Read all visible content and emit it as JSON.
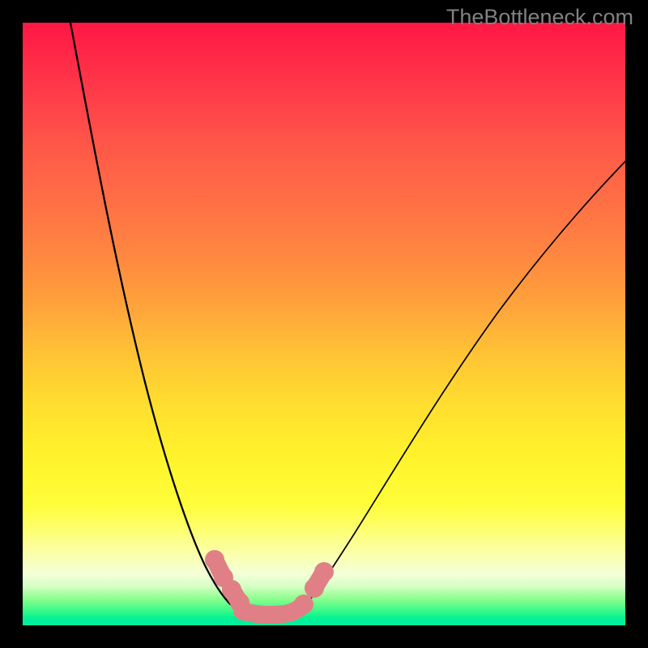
{
  "watermark": "TheBottleneck.com",
  "chart_data": {
    "type": "line",
    "title": "",
    "xlabel": "",
    "ylabel": "",
    "xlim": [
      0,
      100
    ],
    "ylim": [
      0,
      100
    ],
    "grid": false,
    "series": [
      {
        "name": "bottleneck-curve",
        "x": [
          8,
          12,
          18,
          24,
          30,
          34,
          37,
          39,
          42,
          46,
          50,
          56,
          64,
          74,
          84,
          94,
          100
        ],
        "y": [
          100,
          82,
          58,
          38,
          22,
          12,
          5,
          2,
          1,
          3,
          8,
          18,
          32,
          48,
          62,
          74,
          80
        ]
      }
    ],
    "annotations": [
      {
        "name": "optimal-zone-markers",
        "x_range": [
          32,
          50
        ],
        "y_range": [
          1,
          12
        ],
        "style": "salmon-beads"
      }
    ],
    "background": {
      "type": "vertical-gradient",
      "stops": [
        {
          "pos": 0.0,
          "color": "#ff1745"
        },
        {
          "pos": 0.3,
          "color": "#ff7045"
        },
        {
          "pos": 0.55,
          "color": "#ffc335"
        },
        {
          "pos": 0.8,
          "color": "#fffd3a"
        },
        {
          "pos": 0.92,
          "color": "#f3ffd8"
        },
        {
          "pos": 1.0,
          "color": "#01eea4"
        }
      ]
    }
  }
}
